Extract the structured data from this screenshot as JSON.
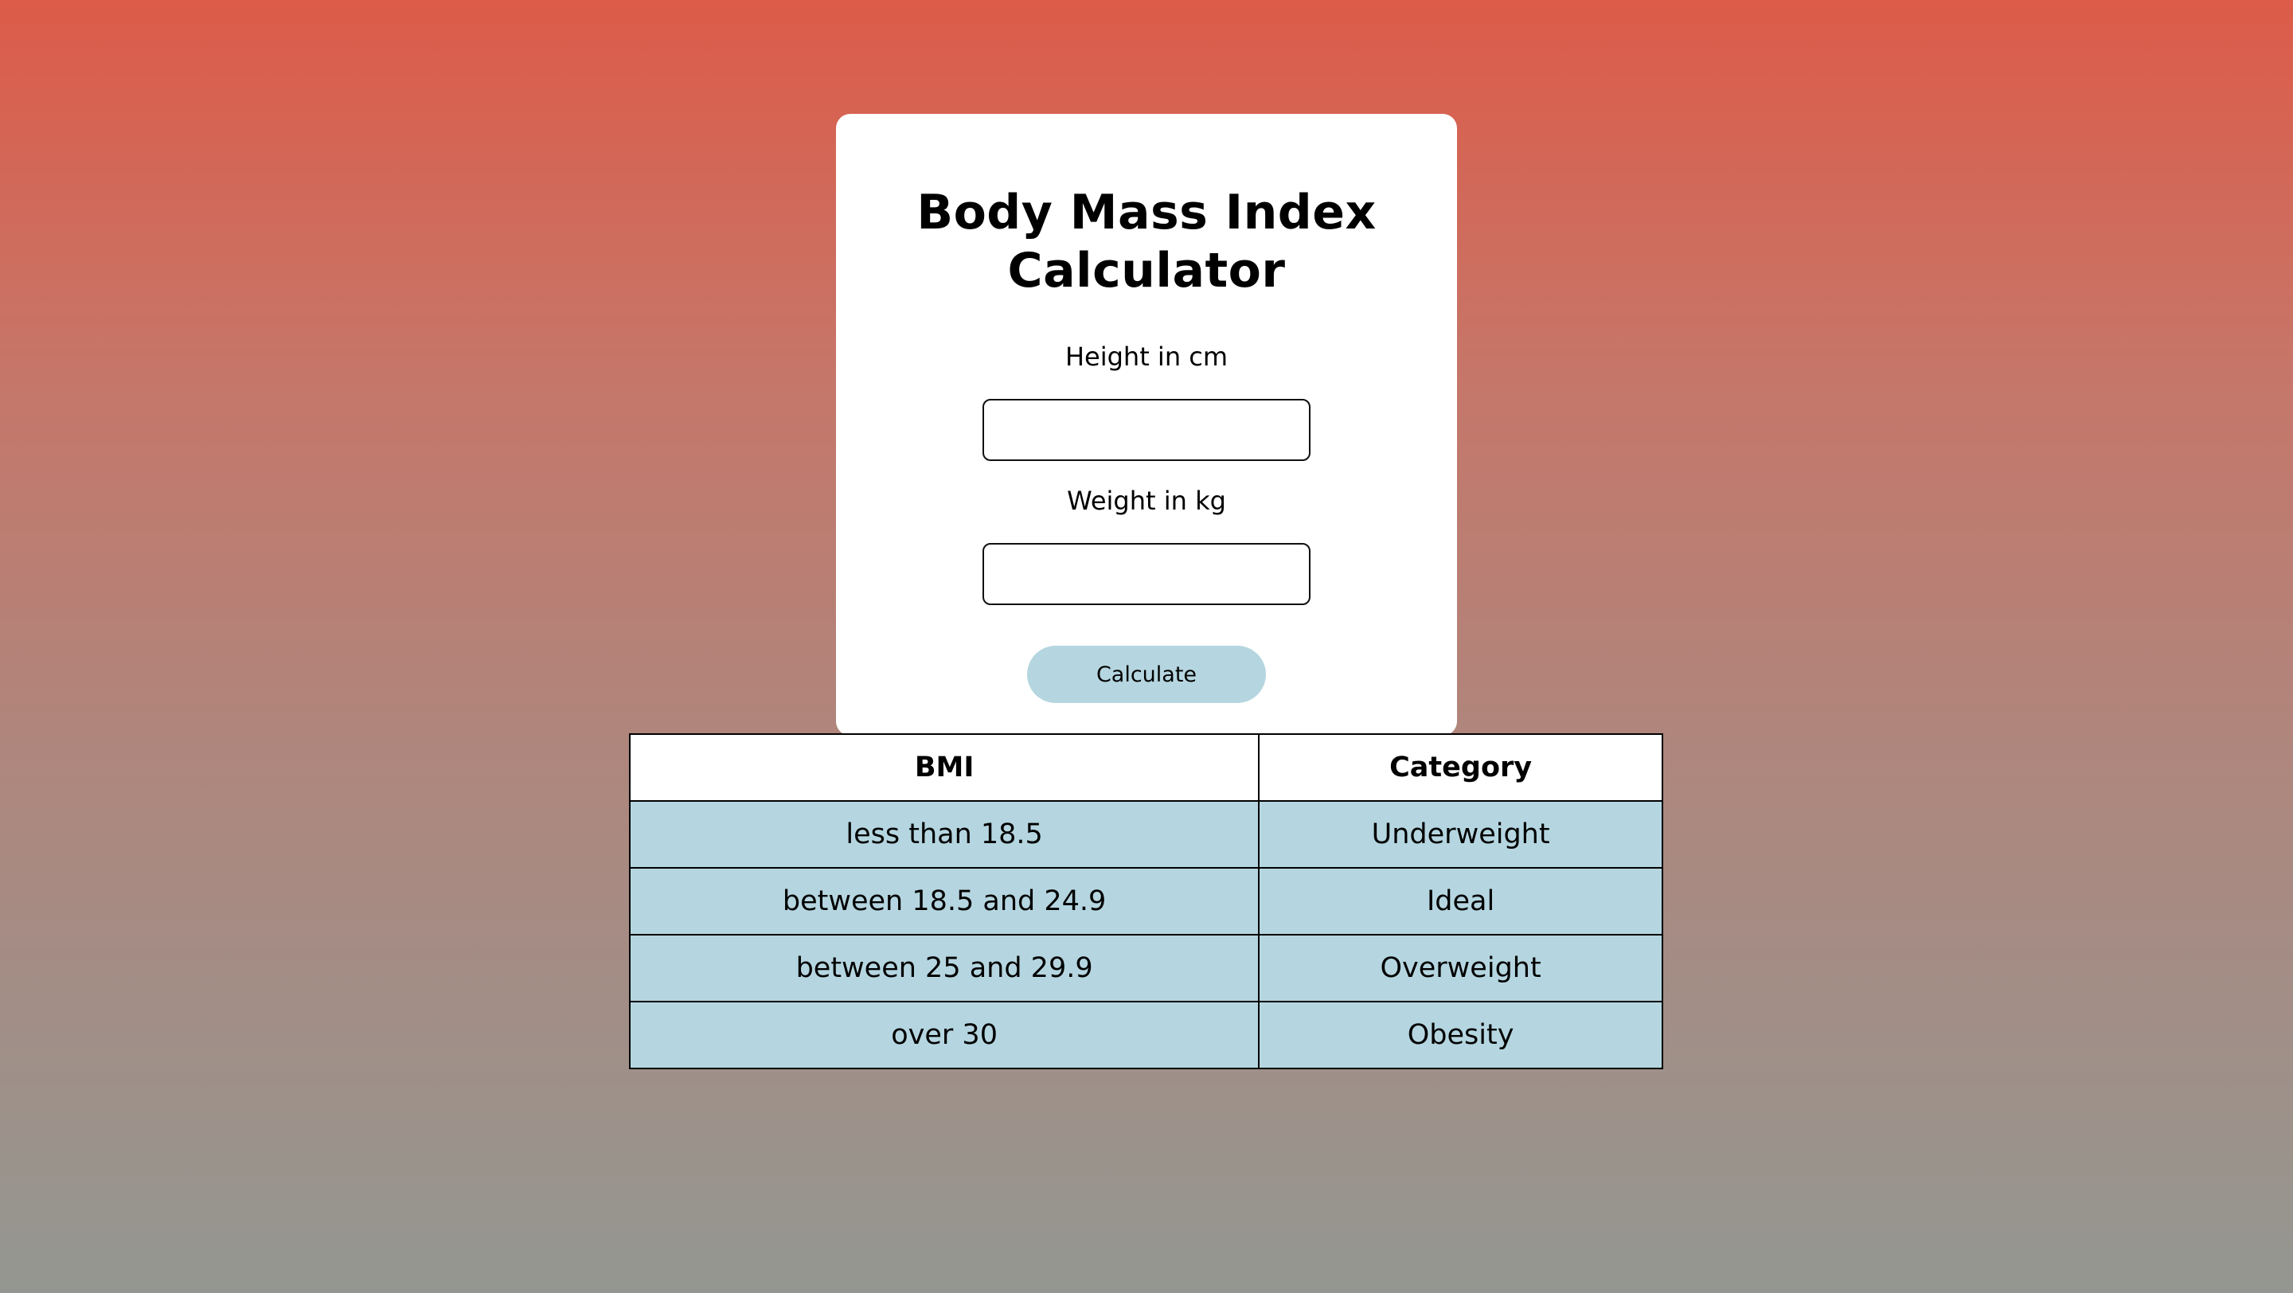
{
  "calculator": {
    "title": "Body Mass Index Calculator",
    "height_label": "Height in cm",
    "height_value": "",
    "weight_label": "Weight in kg",
    "weight_value": "",
    "calculate_label": "Calculate"
  },
  "bmi_table": {
    "headers": [
      "BMI",
      "Category"
    ],
    "rows": [
      [
        "less than 18.5",
        "Underweight"
      ],
      [
        "between 18.5 and 24.9",
        "Ideal"
      ],
      [
        "between 25 and 29.9",
        "Overweight"
      ],
      [
        "over 30",
        "Obesity"
      ]
    ]
  },
  "colors": {
    "gradient_top": "#dd5b49",
    "gradient_bottom": "#949791",
    "accent": "#b5d6e0",
    "card": "#ffffff"
  }
}
